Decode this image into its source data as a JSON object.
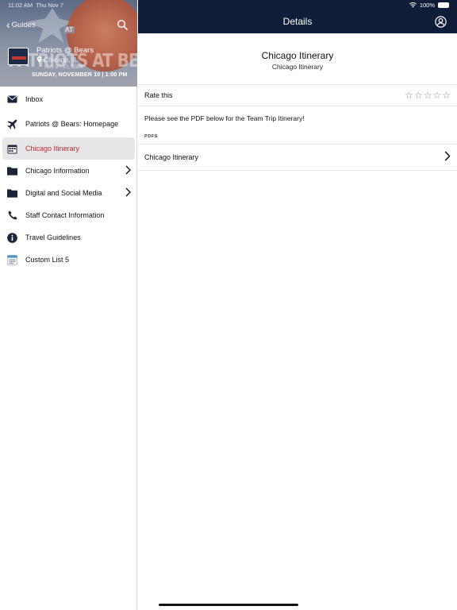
{
  "status_bar": {
    "time": "11:02 AM",
    "day": "Thu Nov 7",
    "battery": "100%"
  },
  "sidebar": {
    "back_label": "Guides",
    "hero": {
      "banner_text": "PATRIOTS AT BEARS",
      "at_label": "AT",
      "date_line": "SUNDAY, NOVEMBER 10 | 1:00 PM"
    },
    "event": {
      "title": "Patriots @ Bears",
      "location": "Chicago, IL",
      "dates": "Nov 9 - 10, 2024"
    },
    "items": [
      {
        "label": "Inbox",
        "icon": "envelope-icon",
        "active": false,
        "has_children": false
      },
      {
        "label": "Patriots @ Bears: Homepage",
        "icon": "airplane-icon",
        "active": false,
        "has_children": false
      },
      {
        "label": "Chicago Itinerary",
        "icon": "calendar-icon",
        "active": true,
        "has_children": false
      },
      {
        "label": "Chicago Information",
        "icon": "folder-icon",
        "active": false,
        "has_children": true
      },
      {
        "label": "Digital and Social Media",
        "icon": "folder-icon",
        "active": false,
        "has_children": true
      },
      {
        "label": "Staff Contact Information",
        "icon": "phone-icon",
        "active": false,
        "has_children": false
      },
      {
        "label": "Travel Guidelines",
        "icon": "info-icon",
        "active": false,
        "has_children": false
      },
      {
        "label": "Custom List 5",
        "icon": "list-icon",
        "active": false,
        "has_children": false
      }
    ]
  },
  "header": {
    "title": "Details"
  },
  "detail": {
    "title": "Chicago Itinerary",
    "subtitle": "Chicago Itinerary",
    "rate_label": "Rate this",
    "rating": 0,
    "rating_max": 5,
    "description": "Please see the PDF below for the Team Trip Itinerary!",
    "pdfs_header": "PDFS",
    "pdfs": [
      {
        "label": "Chicago Itinerary"
      }
    ]
  },
  "colors": {
    "header_bg": "#0f1d38",
    "active_text": "#c0272d",
    "active_bg": "#e7e7e9"
  }
}
